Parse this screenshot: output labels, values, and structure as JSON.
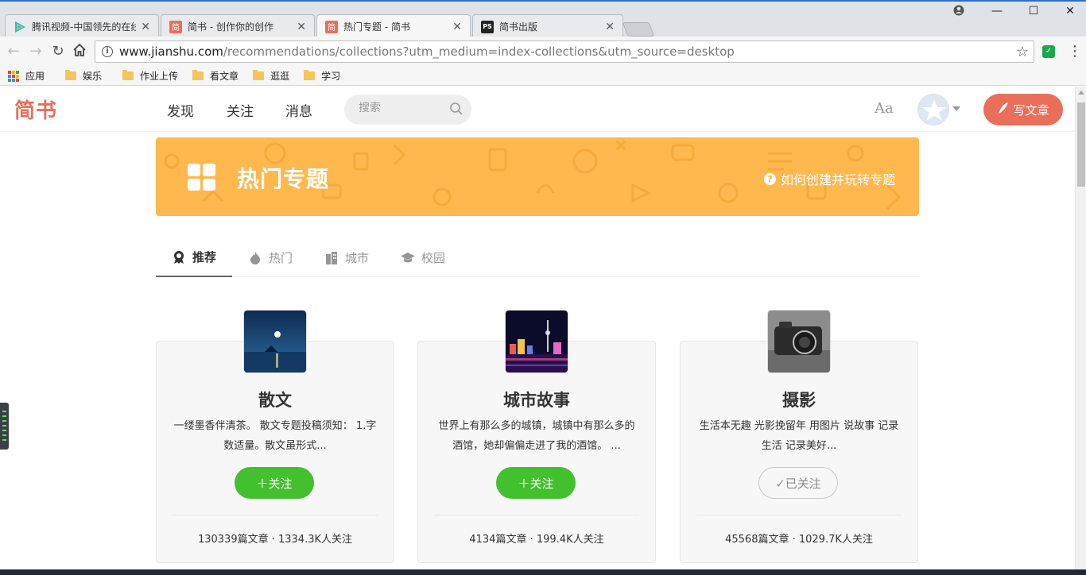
{
  "browser": {
    "tabs": [
      {
        "title": "腾讯视频-中国领先的在线",
        "favicon": "tencent-video-icon",
        "active": false
      },
      {
        "title": "简书 - 创作你的创作",
        "favicon": "jianshu-icon",
        "active": false
      },
      {
        "title": "热门专题 - 简书",
        "favicon": "jianshu-icon",
        "active": true
      },
      {
        "title": "简书出版",
        "favicon": "ps-icon",
        "active": false
      }
    ],
    "url_host": "www.jianshu.com",
    "url_path": "/recommendations/collections?utm_medium=index-collections&utm_source=desktop",
    "bookmarks": [
      "应用",
      "娱乐",
      "作业上传",
      "看文章",
      "逛逛",
      "学习"
    ]
  },
  "header": {
    "logo": "简书",
    "nav": [
      "发现",
      "关注",
      "消息"
    ],
    "search_placeholder": "搜索",
    "font_toggle": "Aa",
    "write_label": "写文章"
  },
  "banner": {
    "title": "热门专题",
    "help_text": "如何创建并玩转专题"
  },
  "tabs": [
    {
      "label": "推荐",
      "icon": "ribbon-icon",
      "active": true
    },
    {
      "label": "热门",
      "icon": "flame-icon",
      "active": false
    },
    {
      "label": "城市",
      "icon": "building-icon",
      "active": false
    },
    {
      "label": "校园",
      "icon": "graduation-cap-icon",
      "active": false
    }
  ],
  "cards": [
    {
      "title": "散文",
      "desc": "一缕墨香伴清茶。 散文专题投稿须知： 1.字数适量。散文虽形式...",
      "button": "＋关注",
      "followed": false,
      "stats": "130339篇文章 · 1334.3K人关注"
    },
    {
      "title": "城市故事",
      "desc": "世界上有那么多的城镇，城镇中有那么多的酒馆，她却偏偏走进了我的酒馆。 ...",
      "button": "＋关注",
      "followed": false,
      "stats": "4134篇文章 · 199.4K人关注"
    },
    {
      "title": "摄影",
      "desc": "生活本无趣   光影挽留年 用图片 说故事 记录生活 记录美好...",
      "button": "✓已关注",
      "followed": true,
      "stats": "45568篇文章 · 1029.7K人关注"
    }
  ],
  "colors": {
    "brand": "#ea6f5a",
    "banner": "#ffb84e",
    "follow_green": "#42c02e"
  }
}
